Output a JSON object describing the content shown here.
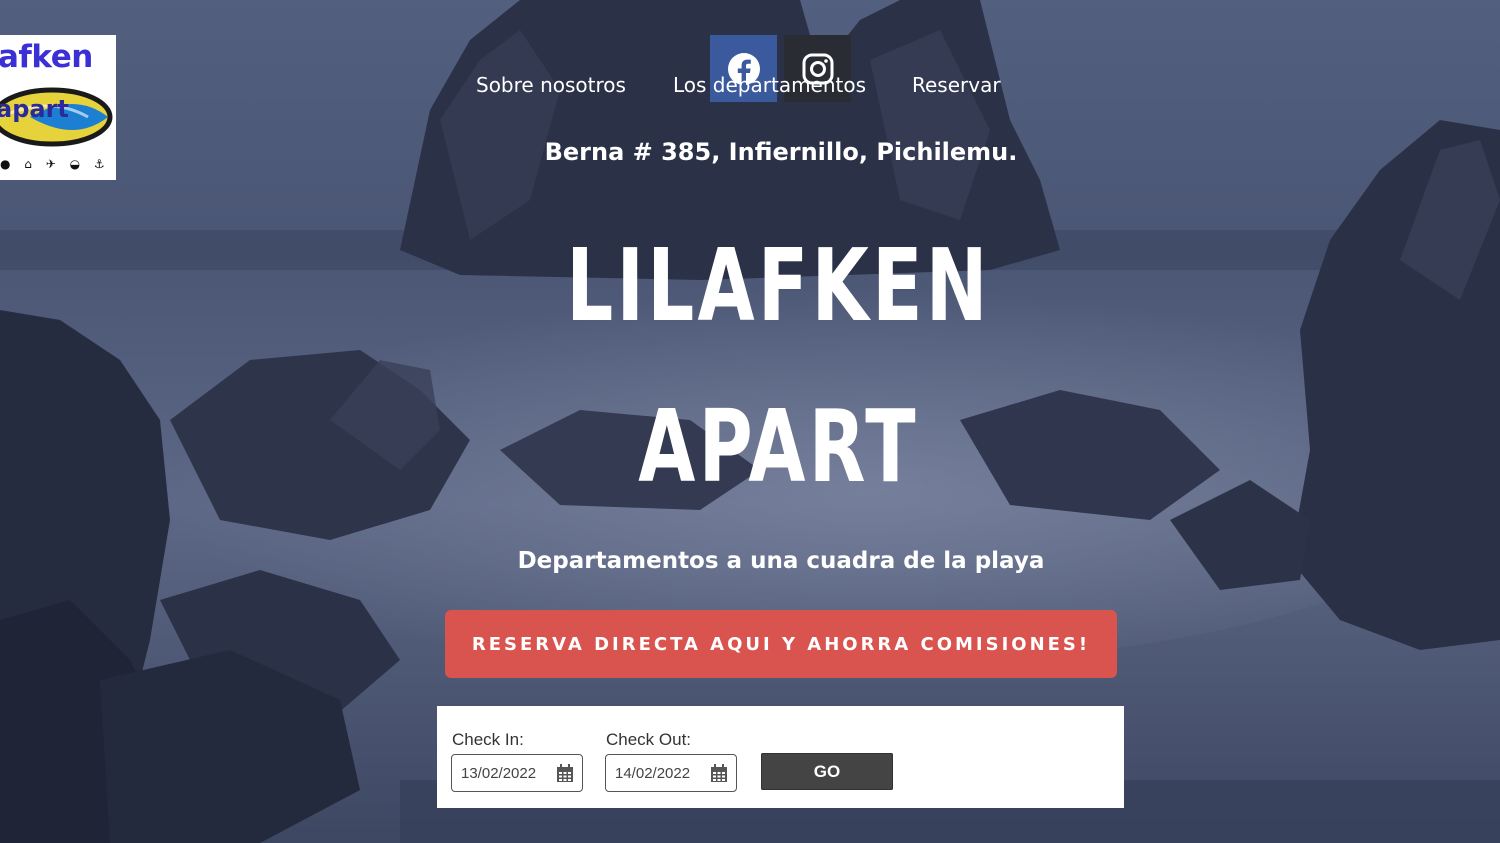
{
  "logo": {
    "line1": "afken",
    "line2": "apart",
    "icon_row": "● ⌂ ✈ ◒ ⚓"
  },
  "social": {
    "facebook_icon": "facebook-icon",
    "instagram_icon": "instagram-icon",
    "facebook_color": "#3b5a9e",
    "instagram_color": "#2a2c33"
  },
  "nav": {
    "items": [
      {
        "label": "Sobre nosotros"
      },
      {
        "label": "Los departamentos"
      },
      {
        "label": "Reservar"
      }
    ]
  },
  "hero": {
    "address": "Berna # 385, Infiernillo, Pichilemu.",
    "title_line1": "LILAFKEN",
    "title_line2": "APART",
    "subtitle": "Departamentos a una cuadra de la playa",
    "cta_label": "RESERVA DIRECTA AQUI Y AHORRA COMISIONES!",
    "cta_color": "#d9534f"
  },
  "booking": {
    "checkin_label": "Check In:",
    "checkin_value": "13/02/2022",
    "checkout_label": "Check Out:",
    "checkout_value": "14/02/2022",
    "go_label": "GO",
    "calendar_icon": "calendar-icon"
  }
}
